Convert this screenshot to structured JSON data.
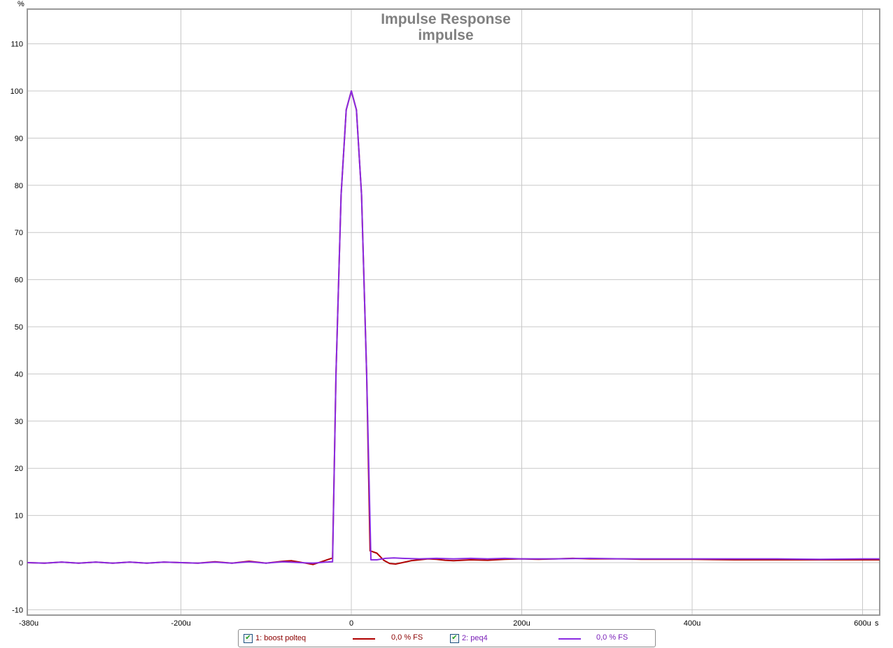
{
  "chart_data": {
    "type": "line",
    "title": "Impulse Response",
    "subtitle": "impulse",
    "ylabel": "%",
    "xunit": "s",
    "xlim": [
      -380,
      620
    ],
    "ylim": [
      -11,
      119
    ],
    "x_ticks": [
      {
        "value": -380,
        "label": "-380u"
      },
      {
        "value": -200,
        "label": "-200u"
      },
      {
        "value": 0,
        "label": "0"
      },
      {
        "value": 200,
        "label": "200u"
      },
      {
        "value": 400,
        "label": "400u"
      },
      {
        "value": 600,
        "label": "600u"
      }
    ],
    "y_ticks": [
      -10,
      0,
      10,
      20,
      30,
      40,
      50,
      60,
      70,
      80,
      90,
      100,
      110
    ],
    "grid": true,
    "legend_position": "bottom",
    "series": [
      {
        "name": "1: boost polteq",
        "color": "#b00000",
        "legend_value": "0,0 % FS",
        "points": [
          [
            -380,
            0
          ],
          [
            -360,
            -0.1
          ],
          [
            -340,
            0.1
          ],
          [
            -320,
            -0.1
          ],
          [
            -300,
            0.1
          ],
          [
            -280,
            -0.1
          ],
          [
            -260,
            0.1
          ],
          [
            -240,
            -0.1
          ],
          [
            -220,
            0.1
          ],
          [
            -200,
            0
          ],
          [
            -180,
            -0.1
          ],
          [
            -160,
            0.2
          ],
          [
            -140,
            -0.1
          ],
          [
            -120,
            0.3
          ],
          [
            -100,
            -0.1
          ],
          [
            -80,
            0.3
          ],
          [
            -70,
            0.4
          ],
          [
            -60,
            0.1
          ],
          [
            -45,
            -0.4
          ],
          [
            -35,
            0.2
          ],
          [
            -25,
            0.8
          ],
          [
            -22,
            1.0
          ],
          [
            -18,
            40
          ],
          [
            -12,
            78
          ],
          [
            -6,
            96
          ],
          [
            0,
            100
          ],
          [
            6,
            96
          ],
          [
            12,
            78
          ],
          [
            18,
            40
          ],
          [
            22,
            2.5
          ],
          [
            30,
            2.0
          ],
          [
            38,
            0.5
          ],
          [
            45,
            -0.2
          ],
          [
            52,
            -0.3
          ],
          [
            60,
            0
          ],
          [
            70,
            0.4
          ],
          [
            80,
            0.6
          ],
          [
            90,
            0.8
          ],
          [
            100,
            0.7
          ],
          [
            110,
            0.5
          ],
          [
            120,
            0.4
          ],
          [
            130,
            0.5
          ],
          [
            140,
            0.6
          ],
          [
            160,
            0.5
          ],
          [
            180,
            0.7
          ],
          [
            200,
            0.8
          ],
          [
            220,
            0.7
          ],
          [
            240,
            0.8
          ],
          [
            260,
            0.9
          ],
          [
            280,
            0.8
          ],
          [
            300,
            0.8
          ],
          [
            320,
            0.8
          ],
          [
            340,
            0.7
          ],
          [
            360,
            0.7
          ],
          [
            380,
            0.7
          ],
          [
            400,
            0.7
          ],
          [
            450,
            0.6
          ],
          [
            500,
            0.6
          ],
          [
            550,
            0.6
          ],
          [
            600,
            0.6
          ],
          [
            620,
            0.6
          ]
        ]
      },
      {
        "name": "2: peq4",
        "color": "#8a2be2",
        "legend_value": "0,0 % FS",
        "points": [
          [
            -380,
            0
          ],
          [
            -360,
            -0.1
          ],
          [
            -340,
            0.1
          ],
          [
            -320,
            -0.1
          ],
          [
            -300,
            0.1
          ],
          [
            -280,
            -0.1
          ],
          [
            -260,
            0.1
          ],
          [
            -240,
            -0.1
          ],
          [
            -220,
            0.1
          ],
          [
            -200,
            0
          ],
          [
            -180,
            -0.1
          ],
          [
            -160,
            0.1
          ],
          [
            -140,
            -0.1
          ],
          [
            -120,
            0.2
          ],
          [
            -100,
            -0.1
          ],
          [
            -80,
            0.2
          ],
          [
            -60,
            0
          ],
          [
            -45,
            -0.1
          ],
          [
            -30,
            0.1
          ],
          [
            -22,
            0.2
          ],
          [
            -18,
            40
          ],
          [
            -12,
            78
          ],
          [
            -6,
            96
          ],
          [
            0,
            100
          ],
          [
            6,
            96
          ],
          [
            12,
            78
          ],
          [
            18,
            40
          ],
          [
            23,
            0.6
          ],
          [
            30,
            0.6
          ],
          [
            40,
            0.9
          ],
          [
            50,
            1.0
          ],
          [
            60,
            0.9
          ],
          [
            80,
            0.8
          ],
          [
            100,
            0.9
          ],
          [
            120,
            0.8
          ],
          [
            140,
            0.9
          ],
          [
            160,
            0.8
          ],
          [
            180,
            0.9
          ],
          [
            200,
            0.8
          ],
          [
            240,
            0.8
          ],
          [
            280,
            0.9
          ],
          [
            320,
            0.8
          ],
          [
            360,
            0.8
          ],
          [
            400,
            0.8
          ],
          [
            450,
            0.8
          ],
          [
            500,
            0.8
          ],
          [
            550,
            0.7
          ],
          [
            600,
            0.8
          ],
          [
            620,
            0.8
          ]
        ]
      }
    ]
  }
}
